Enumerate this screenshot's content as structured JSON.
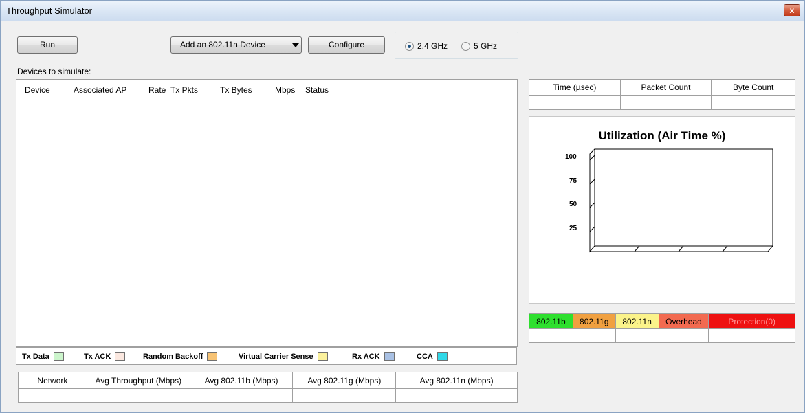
{
  "window": {
    "title": "Throughput Simulator",
    "close_glyph": "x"
  },
  "toolbar": {
    "run_label": "Run",
    "add_device_label": "Add an 802.11n Device",
    "configure_label": "Configure",
    "band_options": [
      {
        "label": "2.4 GHz",
        "selected": true
      },
      {
        "label": "5 GHz",
        "selected": false
      }
    ]
  },
  "devices": {
    "caption": "Devices to simulate:",
    "columns": [
      "Device",
      "Associated AP",
      "Rate",
      "Tx Pkts",
      "Tx Bytes",
      "Mbps",
      "Status"
    ],
    "rows": []
  },
  "legend": [
    {
      "label": "Tx Data",
      "color": "#ccf5cc"
    },
    {
      "label": "Tx ACK",
      "color": "#fbe8e0"
    },
    {
      "label": "Random Backoff",
      "color": "#f7c374"
    },
    {
      "label": "Virtual Carrier Sense",
      "color": "#fbf19c"
    },
    {
      "label": "Rx ACK",
      "color": "#a9c1e4"
    },
    {
      "label": "CCA",
      "color": "#2fd8e8"
    }
  ],
  "summary": {
    "columns": [
      "Network",
      "Avg Throughput (Mbps)",
      "Avg 802.11b (Mbps)",
      "Avg 802.11g (Mbps)",
      "Avg 802.11n (Mbps)"
    ],
    "values": [
      "",
      "",
      "",
      "",
      ""
    ]
  },
  "stats": {
    "columns": [
      "Time (µsec)",
      "Packet Count",
      "Byte Count"
    ],
    "values": [
      "",
      "",
      ""
    ]
  },
  "chart_data": {
    "type": "bar",
    "title": "Utilization (Air Time %)",
    "y_ticks": [
      "100",
      "75",
      "50",
      "25"
    ],
    "ylim": [
      0,
      100
    ],
    "categories": [],
    "values": []
  },
  "utilization": {
    "cells": [
      {
        "label": "802.11b",
        "color": "#2ee02e",
        "text_color": "#000000"
      },
      {
        "label": "802.11g",
        "color": "#f0a040",
        "text_color": "#000000"
      },
      {
        "label": "802.11n",
        "color": "#fbf38a",
        "text_color": "#000000"
      },
      {
        "label": "Overhead",
        "color": "#f26a50",
        "text_color": "#000000"
      },
      {
        "label": "Protection(0)",
        "color": "#ee1111",
        "text_color": "#ff9a9a"
      }
    ]
  }
}
